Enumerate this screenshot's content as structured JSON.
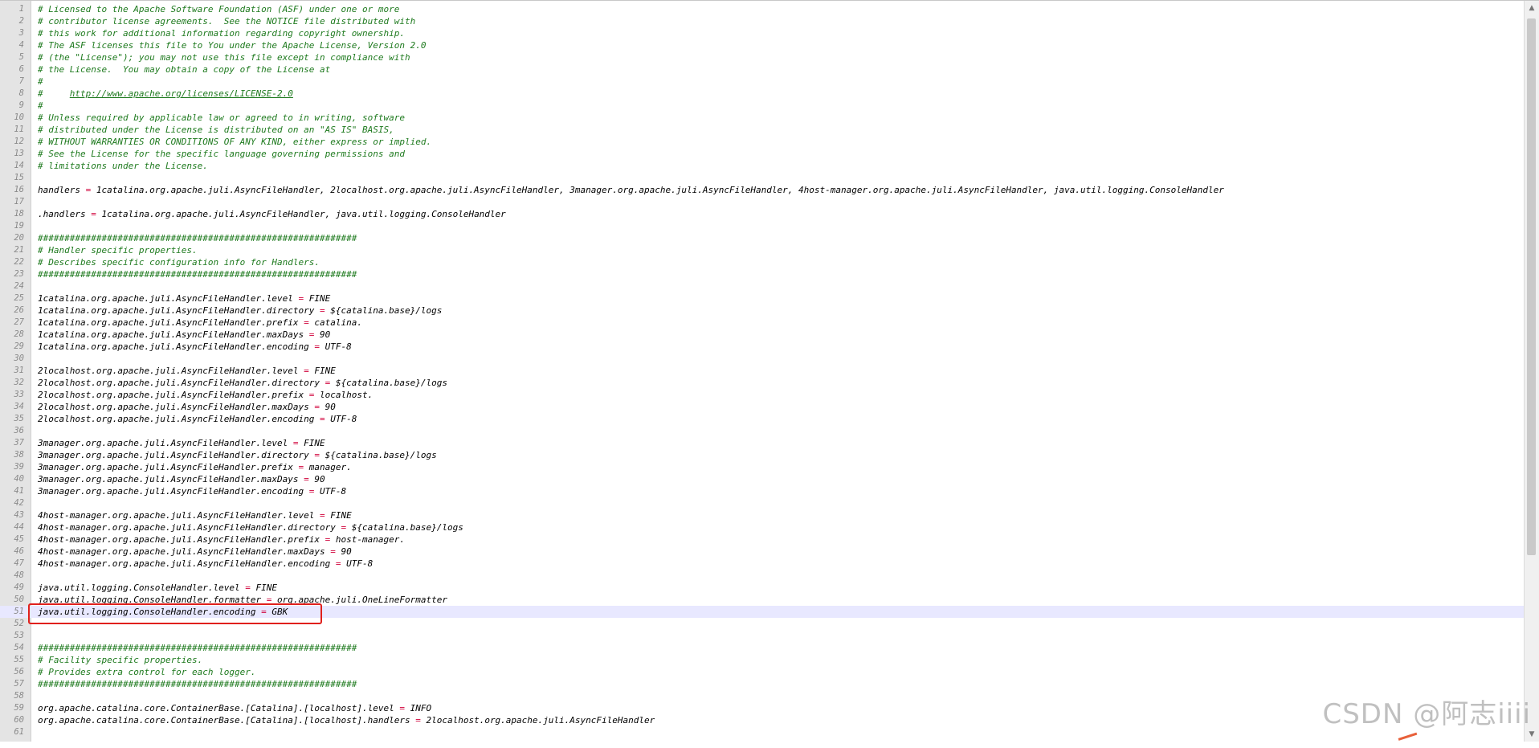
{
  "editor": {
    "current_line": 51,
    "highlighted_line": 51,
    "lines": [
      {
        "n": "1",
        "text": "# Licensed to the Apache Software Foundation (ASF) under one or more",
        "kind": "comment"
      },
      {
        "n": "2",
        "text": "# contributor license agreements.  See the NOTICE file distributed with",
        "kind": "comment"
      },
      {
        "n": "3",
        "text": "# this work for additional information regarding copyright ownership.",
        "kind": "comment"
      },
      {
        "n": "4",
        "text": "# The ASF licenses this file to You under the Apache License, Version 2.0",
        "kind": "comment"
      },
      {
        "n": "5",
        "text": "# (the \"License\"); you may not use this file except in compliance with",
        "kind": "comment"
      },
      {
        "n": "6",
        "text": "# the License.  You may obtain a copy of the License at",
        "kind": "comment"
      },
      {
        "n": "7",
        "text": "#",
        "kind": "comment"
      },
      {
        "n": "8",
        "text": "#     ",
        "link": "http://www.apache.org/licenses/LICENSE-2.0",
        "kind": "link"
      },
      {
        "n": "9",
        "text": "#",
        "kind": "comment"
      },
      {
        "n": "10",
        "text": "# Unless required by applicable law or agreed to in writing, software",
        "kind": "comment"
      },
      {
        "n": "11",
        "text": "# distributed under the License is distributed on an \"AS IS\" BASIS,",
        "kind": "comment"
      },
      {
        "n": "12",
        "text": "# WITHOUT WARRANTIES OR CONDITIONS OF ANY KIND, either express or implied.",
        "kind": "comment"
      },
      {
        "n": "13",
        "text": "# See the License for the specific language governing permissions and",
        "kind": "comment"
      },
      {
        "n": "14",
        "text": "# limitations under the License.",
        "kind": "comment"
      },
      {
        "n": "15",
        "text": "",
        "kind": "blank"
      },
      {
        "n": "16",
        "key": "handlers",
        "value": "1catalina.org.apache.juli.AsyncFileHandler, 2localhost.org.apache.juli.AsyncFileHandler, 3manager.org.apache.juli.AsyncFileHandler, 4host-manager.org.apache.juli.AsyncFileHandler, java.util.logging.ConsoleHandler",
        "kind": "prop"
      },
      {
        "n": "17",
        "text": "",
        "kind": "blank"
      },
      {
        "n": "18",
        "key": ".handlers",
        "value": "1catalina.org.apache.juli.AsyncFileHandler, java.util.logging.ConsoleHandler",
        "kind": "prop"
      },
      {
        "n": "19",
        "text": "",
        "kind": "blank"
      },
      {
        "n": "20",
        "text": "############################################################",
        "kind": "comment"
      },
      {
        "n": "21",
        "text": "# Handler specific properties.",
        "kind": "comment"
      },
      {
        "n": "22",
        "text": "# Describes specific configuration info for Handlers.",
        "kind": "comment"
      },
      {
        "n": "23",
        "text": "############################################################",
        "kind": "comment"
      },
      {
        "n": "24",
        "text": "",
        "kind": "blank"
      },
      {
        "n": "25",
        "key": "1catalina.org.apache.juli.AsyncFileHandler.level",
        "value": "FINE",
        "kind": "prop"
      },
      {
        "n": "26",
        "key": "1catalina.org.apache.juli.AsyncFileHandler.directory",
        "value": "${catalina.base}/logs",
        "kind": "prop"
      },
      {
        "n": "27",
        "key": "1catalina.org.apache.juli.AsyncFileHandler.prefix",
        "value": "catalina.",
        "kind": "prop"
      },
      {
        "n": "28",
        "key": "1catalina.org.apache.juli.AsyncFileHandler.maxDays",
        "value": "90",
        "kind": "prop"
      },
      {
        "n": "29",
        "key": "1catalina.org.apache.juli.AsyncFileHandler.encoding",
        "value": "UTF-8",
        "kind": "prop"
      },
      {
        "n": "30",
        "text": "",
        "kind": "blank"
      },
      {
        "n": "31",
        "key": "2localhost.org.apache.juli.AsyncFileHandler.level",
        "value": "FINE",
        "kind": "prop"
      },
      {
        "n": "32",
        "key": "2localhost.org.apache.juli.AsyncFileHandler.directory",
        "value": "${catalina.base}/logs",
        "kind": "prop"
      },
      {
        "n": "33",
        "key": "2localhost.org.apache.juli.AsyncFileHandler.prefix",
        "value": "localhost.",
        "kind": "prop"
      },
      {
        "n": "34",
        "key": "2localhost.org.apache.juli.AsyncFileHandler.maxDays",
        "value": "90",
        "kind": "prop"
      },
      {
        "n": "35",
        "key": "2localhost.org.apache.juli.AsyncFileHandler.encoding",
        "value": "UTF-8",
        "kind": "prop"
      },
      {
        "n": "36",
        "text": "",
        "kind": "blank"
      },
      {
        "n": "37",
        "key": "3manager.org.apache.juli.AsyncFileHandler.level",
        "value": "FINE",
        "kind": "prop"
      },
      {
        "n": "38",
        "key": "3manager.org.apache.juli.AsyncFileHandler.directory",
        "value": "${catalina.base}/logs",
        "kind": "prop"
      },
      {
        "n": "39",
        "key": "3manager.org.apache.juli.AsyncFileHandler.prefix",
        "value": "manager.",
        "kind": "prop"
      },
      {
        "n": "40",
        "key": "3manager.org.apache.juli.AsyncFileHandler.maxDays",
        "value": "90",
        "kind": "prop"
      },
      {
        "n": "41",
        "key": "3manager.org.apache.juli.AsyncFileHandler.encoding",
        "value": "UTF-8",
        "kind": "prop"
      },
      {
        "n": "42",
        "text": "",
        "kind": "blank"
      },
      {
        "n": "43",
        "key": "4host-manager.org.apache.juli.AsyncFileHandler.level",
        "value": "FINE",
        "kind": "prop"
      },
      {
        "n": "44",
        "key": "4host-manager.org.apache.juli.AsyncFileHandler.directory",
        "value": "${catalina.base}/logs",
        "kind": "prop"
      },
      {
        "n": "45",
        "key": "4host-manager.org.apache.juli.AsyncFileHandler.prefix",
        "value": "host-manager.",
        "kind": "prop"
      },
      {
        "n": "46",
        "key": "4host-manager.org.apache.juli.AsyncFileHandler.maxDays",
        "value": "90",
        "kind": "prop"
      },
      {
        "n": "47",
        "key": "4host-manager.org.apache.juli.AsyncFileHandler.encoding",
        "value": "UTF-8",
        "kind": "prop"
      },
      {
        "n": "48",
        "text": "",
        "kind": "blank"
      },
      {
        "n": "49",
        "key": "java.util.logging.ConsoleHandler.level",
        "value": "FINE",
        "kind": "prop"
      },
      {
        "n": "50",
        "key": "java.util.logging.ConsoleHandler.formatter",
        "value": "org.apache.juli.OneLineFormatter",
        "kind": "prop"
      },
      {
        "n": "51",
        "key": "java.util.logging.ConsoleHandler.encoding",
        "value": "GBK",
        "kind": "prop"
      },
      {
        "n": "52",
        "text": "",
        "kind": "blank"
      },
      {
        "n": "53",
        "text": "",
        "kind": "blank"
      },
      {
        "n": "54",
        "text": "############################################################",
        "kind": "comment"
      },
      {
        "n": "55",
        "text": "# Facility specific properties.",
        "kind": "comment"
      },
      {
        "n": "56",
        "text": "# Provides extra control for each logger.",
        "kind": "comment"
      },
      {
        "n": "57",
        "text": "############################################################",
        "kind": "comment"
      },
      {
        "n": "58",
        "text": "",
        "kind": "blank"
      },
      {
        "n": "59",
        "key": "org.apache.catalina.core.ContainerBase.[Catalina].[localhost].level",
        "value": "INFO",
        "kind": "prop"
      },
      {
        "n": "60",
        "key": "org.apache.catalina.core.ContainerBase.[Catalina].[localhost].handlers",
        "value": "2localhost.org.apache.juli.AsyncFileHandler",
        "kind": "prop"
      },
      {
        "n": "61",
        "text": "",
        "kind": "blank"
      }
    ],
    "operator": " = "
  },
  "watermark": {
    "text": "CSDN @阿志iiii"
  },
  "icons": {
    "scroll_up": "▲",
    "scroll_down": "▼"
  },
  "colors": {
    "comment": "#1e7a1e",
    "operator": "#d0003a",
    "highlight_box": "#e0201c",
    "current_line": "#e8e8ff"
  }
}
